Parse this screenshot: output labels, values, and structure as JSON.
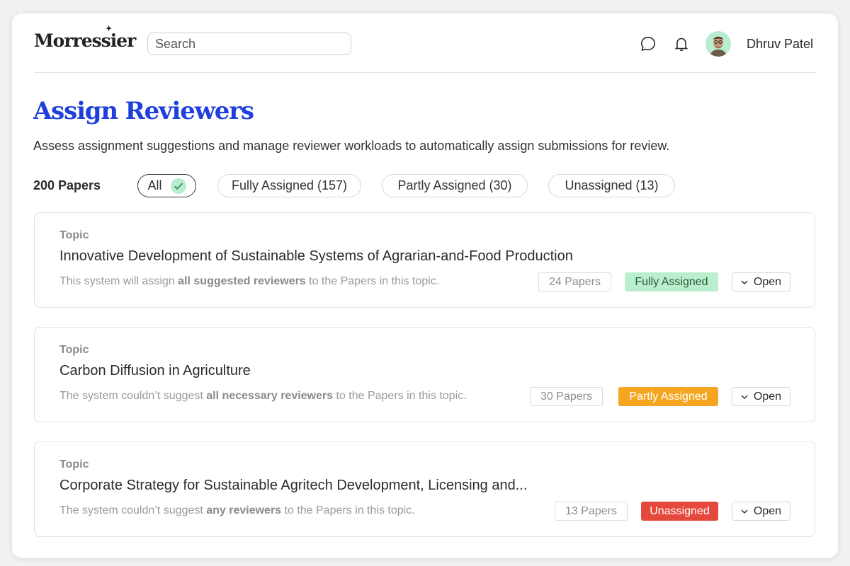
{
  "header": {
    "logo": "Morressier",
    "search_placeholder": "Search",
    "user_name": "Dhruv Patel",
    "icons": [
      "chat-icon",
      "bell-icon"
    ]
  },
  "page": {
    "title": "Assign Reviewers",
    "description": "Assess assignment suggestions and manage reviewer workloads to automatically assign submissions for review."
  },
  "filters": {
    "total": "200 Papers",
    "chips": [
      {
        "label": "All",
        "active": true
      },
      {
        "label": "Fully Assigned (157)",
        "active": false
      },
      {
        "label": "Partly Assigned (30)",
        "active": false
      },
      {
        "label": "Unassigned (13)",
        "active": false
      }
    ]
  },
  "topics": [
    {
      "label": "Topic",
      "title": "Innovative Development of Sustainable Systems of Agrarian-and-Food Production",
      "desc_pre": "This system will assign ",
      "desc_bold": "all suggested reviewers",
      "desc_post": " to the Papers in this topic.",
      "papers": "24 Papers",
      "status": "Fully Assigned",
      "status_bg": "#b9efcd",
      "status_fg": "#2c5a3c",
      "action": "Open"
    },
    {
      "label": "Topic",
      "title": "Carbon Diffusion in Agriculture",
      "desc_pre": "The system couldn’t suggest ",
      "desc_bold": "all necessary reviewers",
      "desc_post": " to the Papers in this topic.",
      "papers": "30 Papers",
      "status": "Partly Assigned",
      "status_bg": "#f4a620",
      "status_fg": "#ffffff",
      "action": "Open"
    },
    {
      "label": "Topic",
      "title": "Corporate Strategy for Sustainable Agritech Development, Licensing and...",
      "desc_pre": "The system couldn’t suggest ",
      "desc_bold": "any reviewers",
      "desc_post": " to the Papers in this topic.",
      "papers": "13 Papers",
      "status": "Unassigned",
      "status_bg": "#e5493d",
      "status_fg": "#ffffff",
      "action": "Open"
    }
  ],
  "colors": {
    "accent": "#1f3fdc",
    "check": "#b9ecd0"
  }
}
